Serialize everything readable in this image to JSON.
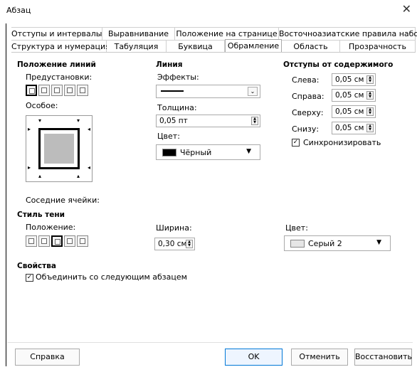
{
  "window": {
    "title": "Абзац",
    "close_glyph": "✕"
  },
  "tabs_row1": [
    {
      "label": "Отступы и интервалы"
    },
    {
      "label": "Выравнивание"
    },
    {
      "label": "Положение на странице"
    },
    {
      "label": "Восточноазиатские правила набора"
    }
  ],
  "tabs_row2": [
    {
      "label": "Структура и нумерация"
    },
    {
      "label": "Табуляция"
    },
    {
      "label": "Буквица"
    },
    {
      "label": "Обрамление",
      "active": true
    },
    {
      "label": "Область"
    },
    {
      "label": "Прозрачность"
    }
  ],
  "line_arrangement": {
    "title": "Положение линий",
    "presets_label": "Предустановки:",
    "custom_label": "Особое:",
    "adjacent_label": "Соседние ячейки:"
  },
  "line": {
    "title": "Линия",
    "effects_label": "Эффекты:",
    "thickness_label": "Толщина:",
    "thickness_value": "0,05 пт",
    "color_label": "Цвет:",
    "color_value": "Чёрный",
    "color_hex": "#000000"
  },
  "padding": {
    "title": "Отступы от содержимого",
    "left_label": "Слева:",
    "left_value": "0,05 см",
    "right_label": "Справа:",
    "right_value": "0,05 см",
    "top_label": "Сверху:",
    "top_value": "0,05 см",
    "bottom_label": "Снизу:",
    "bottom_value": "0,05 см",
    "sync_label": "Синхронизировать",
    "sync_checked": true
  },
  "shadow": {
    "title": "Стиль тени",
    "position_label": "Положение:",
    "width_label": "Ширина:",
    "width_value": "0,30 см",
    "color_label": "Цвет:",
    "color_value": "Серый 2",
    "color_hex": "#e6e6e6"
  },
  "properties": {
    "title": "Свойства",
    "merge_label": "Объединить со следующим абзацем",
    "merge_checked": true
  },
  "buttons": {
    "help": "Справка",
    "ok": "OK",
    "cancel": "Отменить",
    "reset": "Восстановить"
  },
  "icons": {
    "check": "✓",
    "dropdown": "▼",
    "chevron": "⌄",
    "spin_up": "▲",
    "spin_down": "▼"
  }
}
